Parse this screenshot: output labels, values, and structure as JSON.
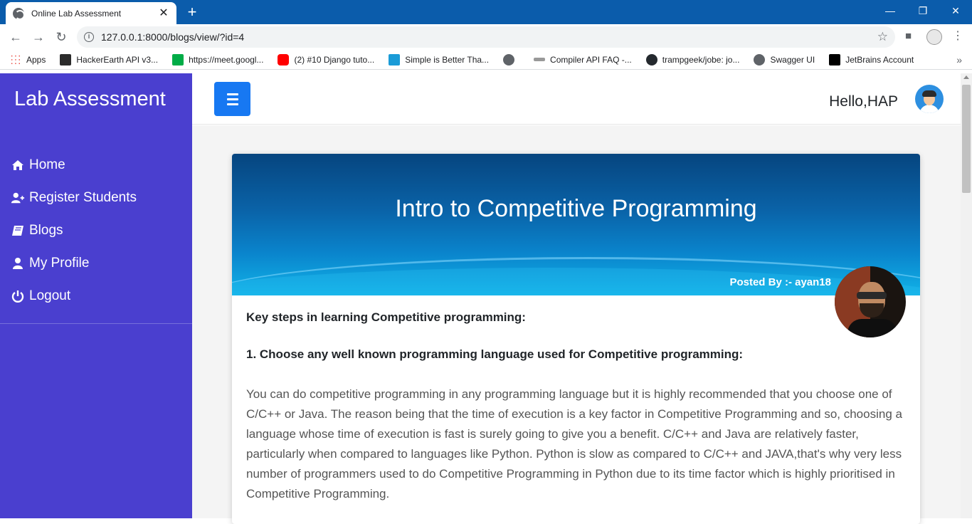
{
  "browser": {
    "tab_title": "Online Lab Assessment",
    "tab_close": "✕",
    "new_tab": "+",
    "url": "127.0.0.1:8000/blogs/view/?id=4",
    "window_controls": {
      "minimize": "—",
      "restore": "❐",
      "close": "✕"
    },
    "bookmarks": [
      {
        "label": "Apps",
        "icon": "apps-grid-icon",
        "color": "#e8453c"
      },
      {
        "label": "HackerEarth API v3...",
        "icon": "hackerearth-icon",
        "color": "#2b2b2b"
      },
      {
        "label": "https://meet.googl...",
        "icon": "google-meet-icon",
        "color": "#00ac47"
      },
      {
        "label": "(2) #10 Django tuto...",
        "icon": "youtube-icon",
        "color": "#ff0000"
      },
      {
        "label": "Simple is Better Tha...",
        "icon": "simple-better-icon",
        "color": "#1a9bd7"
      },
      {
        "label": "",
        "icon": "globe-icon",
        "color": "#5f6368"
      },
      {
        "label": "Compiler API FAQ -...",
        "icon": "compiler-icon",
        "color": "#777777"
      },
      {
        "label": "trampgeek/jobe: jo...",
        "icon": "github-icon",
        "color": "#24292e"
      },
      {
        "label": "Swagger UI",
        "icon": "swagger-icon",
        "color": "#5f6368"
      },
      {
        "label": "JetBrains Account",
        "icon": "jetbrains-icon",
        "color": "#000000"
      }
    ],
    "bookmarks_more": "»"
  },
  "sidebar": {
    "brand": "Lab Assessment",
    "items": [
      {
        "label": "Home",
        "icon": "home-icon"
      },
      {
        "label": "Register Students",
        "icon": "user-plus-icon"
      },
      {
        "label": "Blogs",
        "icon": "book-icon"
      },
      {
        "label": "My Profile",
        "icon": "user-icon"
      },
      {
        "label": "Logout",
        "icon": "power-icon"
      }
    ]
  },
  "header": {
    "greeting": "Hello,HAP"
  },
  "post": {
    "title": "Intro to Competitive Programming",
    "posted_by": "Posted By :- ayan18",
    "heading1": "Key steps in learning Competitive programming:",
    "heading2": "1. Choose any well known programming language used for Competitive programming:",
    "paragraph": "You can do competitive programming in any programming language but it is highly recommended that you choose one of C/C++ or Java. The reason being that the time of execution is a key factor in Competitive Programming and so, choosing a language whose time of execution is fast is surely going to give you a benefit. C/C++ and Java are relatively faster, particularly when compared to languages like Python. Python is slow as compared to C/C++ and JAVA,that's why very less number of programmers used to do Competitive Programming in Python due to its time factor which is highly prioritised in Competitive Programming."
  },
  "colors": {
    "sidebar_bg": "#4a3fcf",
    "menu_button": "#1778f2",
    "browser_frame": "#0b5cab"
  }
}
